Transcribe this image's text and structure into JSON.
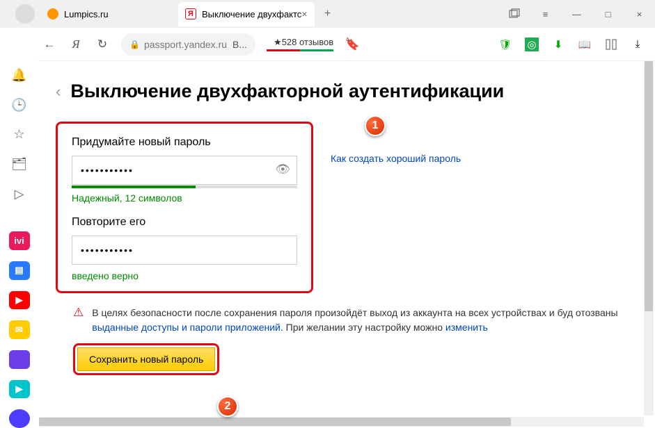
{
  "tabs": {
    "inactive": {
      "title": "Lumpics.ru"
    },
    "active": {
      "title": "Выключение двухфактс",
      "close": "×"
    },
    "new": "+"
  },
  "window_controls": {
    "min": "—",
    "max": "□",
    "close": "×"
  },
  "nav": {
    "url_host": "passport.yandex.ru",
    "url_suffix": "В...",
    "reviews": "★528 отзывов"
  },
  "page": {
    "title": "Выключение двухфакторной аутентификации",
    "back": "‹",
    "field1_label": "Придумайте новый пароль",
    "field1_value": "•••••••••••",
    "strength": "Надежный, 12 символов",
    "field2_label": "Повторите его",
    "field2_value": "•••••••••••",
    "valid": "введено верно",
    "help_link": "Как создать хороший пароль",
    "warning_pre": "В целях безопасности после сохранения пароля произойдёт выход из аккаунта на всех устройствах и буд отозваны ",
    "warning_link1": "выданные доступы и пароли приложений",
    "warning_mid": ". При желании эту настройку можно ",
    "warning_link2": "изменить",
    "save_btn": "Сохранить новый пароль"
  },
  "badges": {
    "b1": "1",
    "b2": "2"
  }
}
